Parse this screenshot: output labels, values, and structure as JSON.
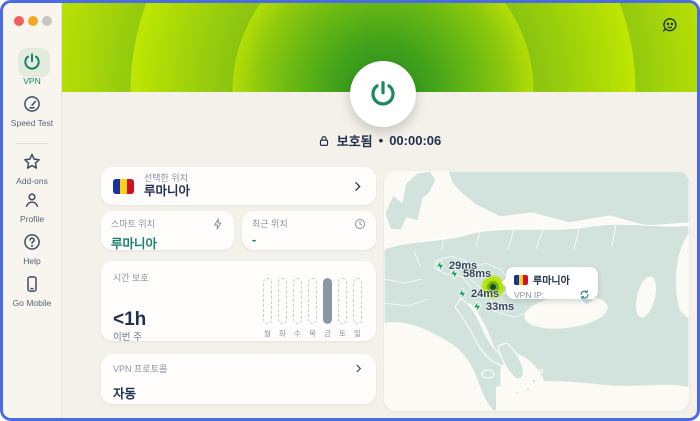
{
  "colors": {
    "accent": "#18806a",
    "power-green": "#1e8a5c",
    "navy": "#22304e",
    "label-gray": "#8a93a3",
    "window-border": "#4a6ce0",
    "bar-fill": "#8a99a8",
    "map-land": "#d2e3dd",
    "bolt-green": "#169d58",
    "lime": "#b7e20a"
  },
  "sidebar": {
    "items": [
      {
        "label": "VPN",
        "icon": "power-icon"
      },
      {
        "label": "Speed Test",
        "icon": "speedometer-icon"
      },
      {
        "label": "Add-ons",
        "icon": "star-icon"
      },
      {
        "label": "Profile",
        "icon": "profile-icon"
      },
      {
        "label": "Help",
        "icon": "help-icon"
      },
      {
        "label": "Go Mobile",
        "icon": "mobile-icon"
      }
    ]
  },
  "status": {
    "text": "보호됨",
    "separator": "•",
    "timer": "00:00:06"
  },
  "cards": {
    "selected": {
      "label": "선택한 위치",
      "value": "루마니아"
    },
    "smart": {
      "label": "스마트 위치",
      "value": "루마니아"
    },
    "recent": {
      "label": "최근 위치",
      "value": "-"
    },
    "time": {
      "label": "시간 보호",
      "value": "<1h",
      "period": "이번 주",
      "days": [
        "월",
        "화",
        "수",
        "목",
        "금",
        "토",
        "일"
      ],
      "active_day_index": 4
    },
    "protocol": {
      "label": "VPN 프로토콜",
      "value": "자동"
    }
  },
  "map": {
    "pings": [
      {
        "value": "29ms"
      },
      {
        "value": "58ms"
      },
      {
        "value": "24ms"
      },
      {
        "value": "33ms"
      }
    ],
    "tooltip": {
      "country": "루마니아",
      "ip_label": "VPN IP:"
    }
  }
}
